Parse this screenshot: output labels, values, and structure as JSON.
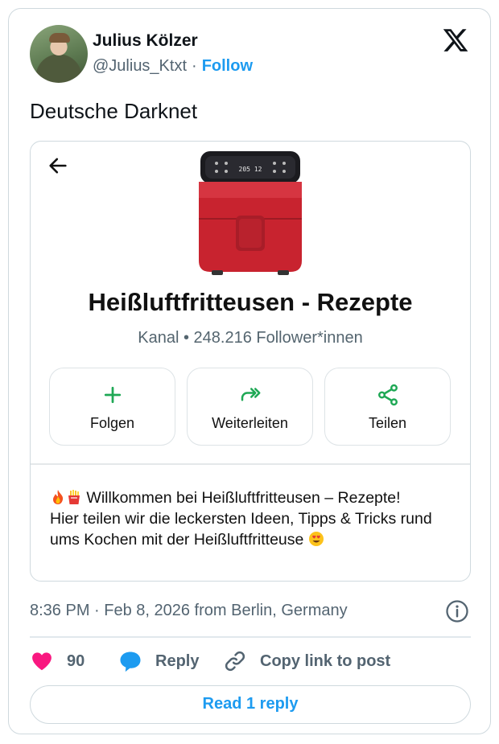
{
  "author": {
    "name": "Julius Kölzer",
    "handle": "@Julius_Ktxt",
    "separator": "·",
    "follow_label": "Follow"
  },
  "tweet": {
    "text": "Deutsche Darknet"
  },
  "embed": {
    "channel_title": "Heißluftfritteusen - Rezepte",
    "channel_subtitle": "Kanal • 248.216 Follower*innen",
    "fryer_display": "205 12",
    "actions": [
      {
        "label": "Folgen",
        "icon": "plus-icon"
      },
      {
        "label": "Weiterleiten",
        "icon": "forward-icon"
      },
      {
        "label": "Teilen",
        "icon": "share-icon"
      }
    ],
    "description_line1": "Willkommen bei Heißluftfritteusen – Rezepte!",
    "description_line2": "Hier teilen wir die leckersten Ideen, Tipps & Tricks rund ums Kochen mit der Heißluftfritteuse"
  },
  "meta": {
    "timestamp": "8:36 PM · Feb 8, 2026 from Berlin, Germany"
  },
  "actions": {
    "like_count": "90",
    "reply_label": "Reply",
    "copy_label": "Copy link to post"
  },
  "read_replies_label": "Read 1 reply",
  "colors": {
    "accent": "#1d9bf0",
    "like": "#f91880",
    "whatsapp_green": "#1fa855",
    "fryer_red": "#c8232f"
  }
}
